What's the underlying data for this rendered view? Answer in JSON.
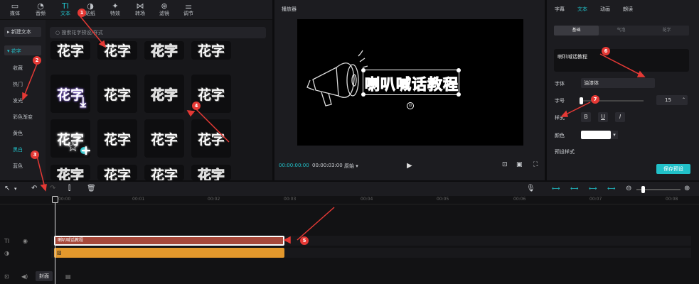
{
  "top_tabs": [
    {
      "label": "媒体",
      "icon": "media-icon"
    },
    {
      "label": "音频",
      "icon": "audio-icon"
    },
    {
      "label": "文本",
      "icon": "text-icon"
    },
    {
      "label": "贴纸",
      "icon": "sticker-icon"
    },
    {
      "label": "特效",
      "icon": "effects-icon"
    },
    {
      "label": "转场",
      "icon": "transition-icon"
    },
    {
      "label": "滤镜",
      "icon": "filter-icon"
    },
    {
      "label": "调节",
      "icon": "adjust-icon"
    }
  ],
  "left_nav": {
    "new_text": "新建文本",
    "items": [
      "花字",
      "收藏",
      "热门",
      "发光",
      "彩色渐变",
      "黄色",
      "黑白",
      "蓝色"
    ],
    "selected_index": 0
  },
  "search": {
    "placeholder": "搜索花字预设/样式"
  },
  "tile_text": "花字",
  "player": {
    "title": "播放器",
    "canvas_text": "喇叭喊话教程",
    "current_time": "00:00:00:00",
    "total_time": "00:00:03:00",
    "ratio_label": "原始"
  },
  "inspector": {
    "tabs": [
      "字幕",
      "文本",
      "动画",
      "朗读"
    ],
    "active_tab": 1,
    "subtabs": [
      "基础",
      "气泡",
      "花字"
    ],
    "text_value": "喇叭喊话教程",
    "font_label": "字体",
    "font_value": "油漆体",
    "size_label": "字号",
    "size_value": "15",
    "style_label": "样式",
    "style_buttons": [
      "B",
      "U",
      "I"
    ],
    "color_label": "颜色",
    "preset_label": "预设样式",
    "save_preset": "保存预设"
  },
  "timeline": {
    "ticks": [
      "00:00",
      "00:01",
      "00:02",
      "00:03",
      "00:04",
      "00:05",
      "00:06",
      "00:07",
      "00:08"
    ],
    "text_clip": "喇叭喊话教程",
    "cover_label": "封面"
  },
  "markers": [
    "1",
    "2",
    "3",
    "4",
    "5",
    "6",
    "7"
  ],
  "colors": {
    "accent": "#21c1c9",
    "annotation": "#e53935",
    "text_clip": "#a6483a",
    "audio_clip": "#e3982c"
  }
}
